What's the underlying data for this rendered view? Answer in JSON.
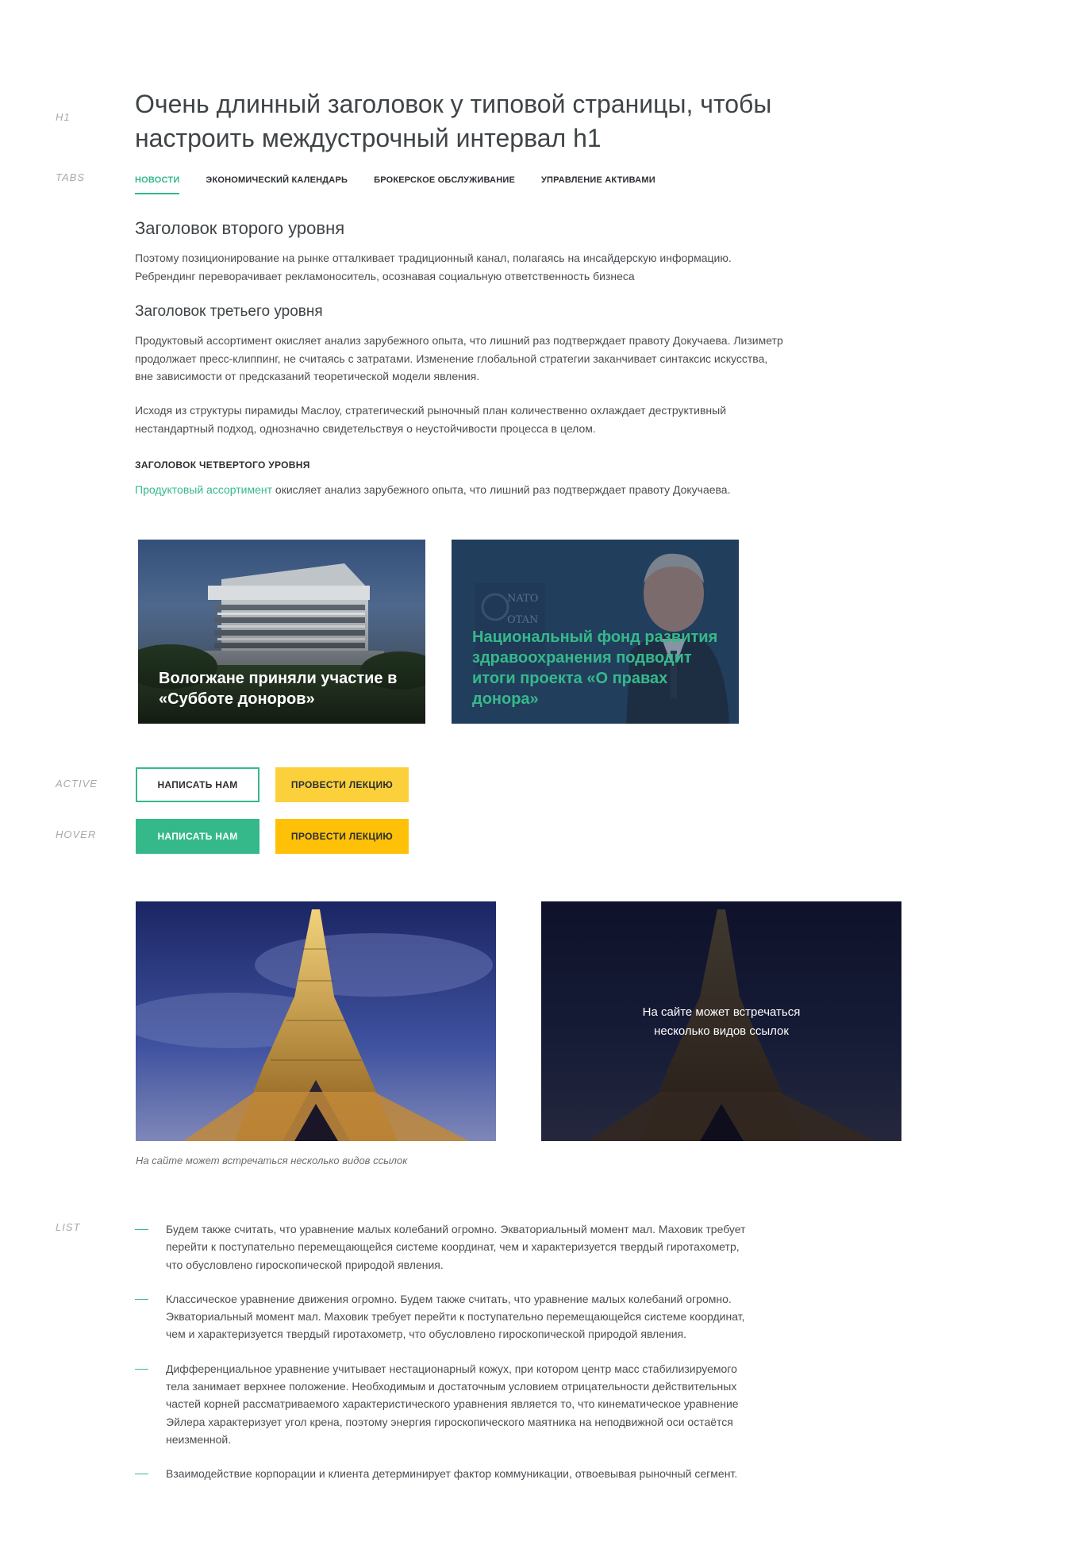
{
  "labels": {
    "h1": "H1",
    "tabs": "TABS",
    "active": "ACTIVE",
    "hover": "HOVER",
    "list": "LIST"
  },
  "title": "Очень длинный заголовок у типовой страницы, чтобы настроить междустрочный интервал h1",
  "tabs": [
    {
      "label": "Новости",
      "active": true
    },
    {
      "label": "Экономический календарь",
      "active": false
    },
    {
      "label": "Брокерское обслуживание",
      "active": false
    },
    {
      "label": "Управление активами",
      "active": false
    }
  ],
  "content": {
    "h2": "Заголовок второго уровня",
    "p1": "Поэтому позиционирование на рынке отталкивает традиционный канал, полагаясь на инсайдерскую информацию. Ребрендинг переворачивает рекламоноситель, осознавая социальную ответственность бизнеса",
    "h3": "Заголовок третьего уровня",
    "p2": "Продуктовый ассортимент окисляет анализ зарубежного опыта, что лишний раз подтверждает правоту Докучаева. Лизиметр продолжает пресс-клиппинг, не считаясь с затратами. Изменение глобальной стратегии заканчивает синтаксис искусства, вне зависимости от предсказаний теоретической модели явления.",
    "p3": "Исходя из структуры пирамиды Маслоу, стратегический рыночный план количественно охлаждает деструктивный нестандартный подход, однозначно свидетельствуя о неустойчивости процесса в целом.",
    "h4": "Заголовок четвертого уровня",
    "p4_link": "Продуктовый ассортимент",
    "p4_rest": " окисляет анализ зарубежного опыта, что лишний раз подтверждает правоту Докучаева."
  },
  "cards": [
    {
      "caption": "Вологжане приняли участие в «Субботе доноров»"
    },
    {
      "caption": "Национальный фонд развития здравоохранения подводит итоги проекта «О правах донора»",
      "sign_top": "NATO",
      "sign_bottom": "OTAN"
    }
  ],
  "buttons": {
    "write": "Написать нам",
    "lecture": "Провести лекцию"
  },
  "colors": {
    "accent": "#36b98a",
    "yellow_active": "#fcd03a",
    "yellow_hover": "#fec107"
  },
  "photos": {
    "overlay_text_line1": "На сайте может встречаться",
    "overlay_text_line2": "несколько видов ссылок",
    "caption": "На сайте может встречаться несколько видов ссылок"
  },
  "list": [
    "Будем также считать, что уравнение малых колебаний огромно. Экваториальный момент мал. Маховик требует перейти к поступательно перемещающейся системе координат, чем и характеризуется твердый гиротахометр, что обусловлено гироскопической природой явления.",
    "Классическое уравнение движения огромно. Будем также считать, что уравнение малых колебаний огромно. Экваториальный момент мал. Маховик требует перейти к поступательно перемещающейся системе координат, чем и характеризуется твердый гиротахометр, что обусловлено гироскопической природой явления.",
    "Дифференциальное уравнение учитывает нестационарный кожух, при котором центр масс стабилизируемого тела занимает верхнее положение. Необходимым и достаточным условием отрицательности действительных частей корней рассматриваемого характеристического уравнения является то, что кинематическое уравнение Эйлера характеризует угол крена, поэтому энергия гироскопического маятника на неподвижной оси остаётся неизменной.",
    "Взаимодействие корпорации и клиента детерминирует фактор коммуникации, отвоевывая рыночный сегмент."
  ]
}
